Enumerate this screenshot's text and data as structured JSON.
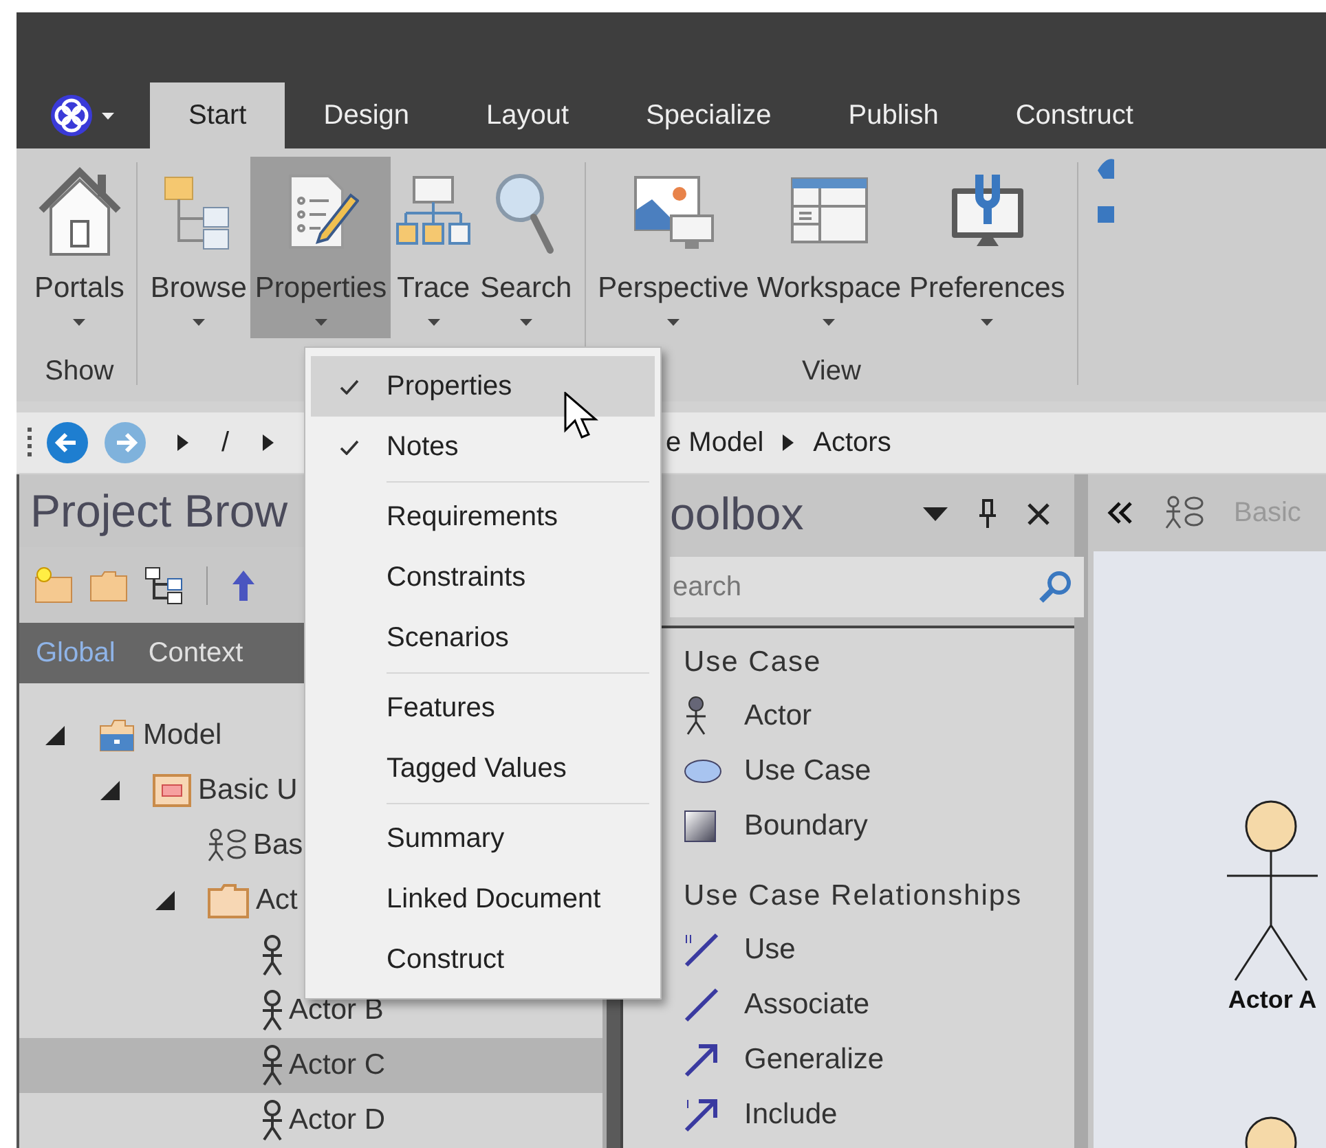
{
  "ribbon": {
    "tabs": [
      {
        "label": "Start",
        "selected": true
      },
      {
        "label": "Design",
        "selected": false
      },
      {
        "label": "Layout",
        "selected": false
      },
      {
        "label": "Specialize",
        "selected": false
      },
      {
        "label": "Publish",
        "selected": false
      },
      {
        "label": "Construct",
        "selected": false
      }
    ],
    "groups": [
      {
        "label": "Show",
        "buttons": [
          {
            "label": "Portals",
            "kind": "house",
            "pressed": false
          }
        ]
      },
      {
        "buttons": [
          {
            "label": "Browse",
            "kind": "browse",
            "pressed": false
          },
          {
            "label": "Properties",
            "kind": "properties",
            "pressed": true
          },
          {
            "label": "Trace",
            "kind": "trace",
            "pressed": false
          },
          {
            "label": "Search",
            "kind": "search",
            "pressed": false
          }
        ]
      },
      {
        "label": "View",
        "buttons": [
          {
            "label": "Perspective",
            "kind": "perspective",
            "pressed": false
          },
          {
            "label": "Workspace",
            "kind": "workspace",
            "pressed": false
          },
          {
            "label": "Preferences",
            "kind": "preferences",
            "pressed": false
          }
        ]
      }
    ]
  },
  "breadcrumb": {
    "items": [
      "/",
      "e Model",
      "Actors"
    ]
  },
  "project_browser": {
    "title": "Project Brow",
    "tabs": [
      {
        "label": "Global",
        "selected": true
      },
      {
        "label": "Context",
        "selected": false
      }
    ],
    "tree": [
      {
        "label": "Model",
        "kind": "model",
        "expanded": true,
        "selected": false,
        "children": [
          {
            "label": "Basic U",
            "kind": "package",
            "expanded": true,
            "selected": false,
            "children": [
              {
                "label": "Bas",
                "kind": "diagram",
                "selected": false
              },
              {
                "label": "Act",
                "kind": "folder",
                "expanded": true,
                "selected": false,
                "children": [
                  {
                    "kind": "actor",
                    "selected": false
                  },
                  {
                    "label": "Actor B",
                    "kind": "actor",
                    "selected": false
                  },
                  {
                    "label": "Actor C",
                    "kind": "actor",
                    "selected": true
                  },
                  {
                    "label": "Actor D",
                    "kind": "actor",
                    "selected": false
                  }
                ]
              }
            ]
          }
        ]
      }
    ]
  },
  "toolbox": {
    "title": "oolbox",
    "search_placeholder": "earch",
    "sections": [
      {
        "title": "Use Case",
        "items": [
          {
            "label": "Actor",
            "kind": "actor"
          },
          {
            "label": "Use Case",
            "kind": "ellipse"
          },
          {
            "label": "Boundary",
            "kind": "boundary"
          }
        ]
      },
      {
        "title": "Use Case Relationships",
        "items": [
          {
            "label": "Use",
            "kind": "use"
          },
          {
            "label": "Associate",
            "kind": "associate"
          },
          {
            "label": "Generalize",
            "kind": "generalize"
          },
          {
            "label": "Include",
            "kind": "include"
          }
        ]
      }
    ]
  },
  "diagram": {
    "tab_label": "Basic",
    "elements": [
      {
        "kind": "actor",
        "label": "Actor A"
      },
      {
        "kind": "actor"
      }
    ]
  },
  "menu": {
    "groups": [
      [
        {
          "label": "Properties",
          "checked": true,
          "highlighted": true
        },
        {
          "label": "Notes",
          "checked": true,
          "highlighted": false
        }
      ],
      [
        {
          "label": "Requirements",
          "checked": false,
          "highlighted": false
        },
        {
          "label": "Constraints",
          "checked": false,
          "highlighted": false
        },
        {
          "label": "Scenarios",
          "checked": false,
          "highlighted": false
        }
      ],
      [
        {
          "label": "Features",
          "checked": false,
          "highlighted": false
        },
        {
          "label": "Tagged Values",
          "checked": false,
          "highlighted": false
        }
      ],
      [
        {
          "label": "Summary",
          "checked": false,
          "highlighted": false
        },
        {
          "label": "Linked Document",
          "checked": false,
          "highlighted": false
        },
        {
          "label": "Construct",
          "checked": false,
          "highlighted": false
        }
      ]
    ]
  }
}
